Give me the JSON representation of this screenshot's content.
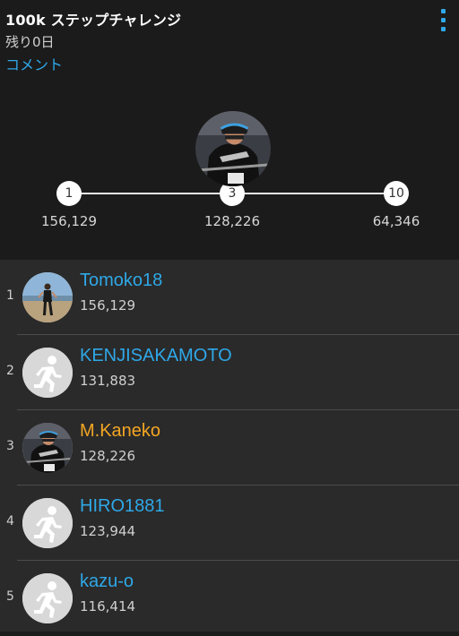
{
  "header": {
    "title": "100k ステップチャレンジ",
    "days_left": "残り0日",
    "comment_link": "コメント",
    "menu_icon": "more-vertical-icon"
  },
  "track": {
    "left": {
      "rank": "1",
      "value": "156,129"
    },
    "center": {
      "rank": "3",
      "value": "128,226"
    },
    "right": {
      "rank": "10",
      "value": "64,346"
    },
    "current_user_avatar": "cyclist-photo"
  },
  "leaderboard": [
    {
      "rank": "1",
      "name": "Tomoko18",
      "steps": "156,129",
      "avatar": "beach-photo",
      "highlight": false
    },
    {
      "rank": "2",
      "name": "KENJISAKAMOTO",
      "steps": "131,883",
      "avatar": "default-runner-icon",
      "highlight": false
    },
    {
      "rank": "3",
      "name": "M.Kaneko",
      "steps": "128,226",
      "avatar": "cyclist-photo",
      "highlight": true
    },
    {
      "rank": "4",
      "name": "HIRO1881",
      "steps": "123,944",
      "avatar": "default-runner-icon",
      "highlight": false
    },
    {
      "rank": "5",
      "name": "kazu-o",
      "steps": "116,414",
      "avatar": "default-runner-icon",
      "highlight": false
    }
  ],
  "colors": {
    "accent_blue": "#2fa8e8",
    "current_user_orange": "#f5a623",
    "header_bg": "#1b1b1b",
    "list_bg": "#2a2a2a"
  }
}
